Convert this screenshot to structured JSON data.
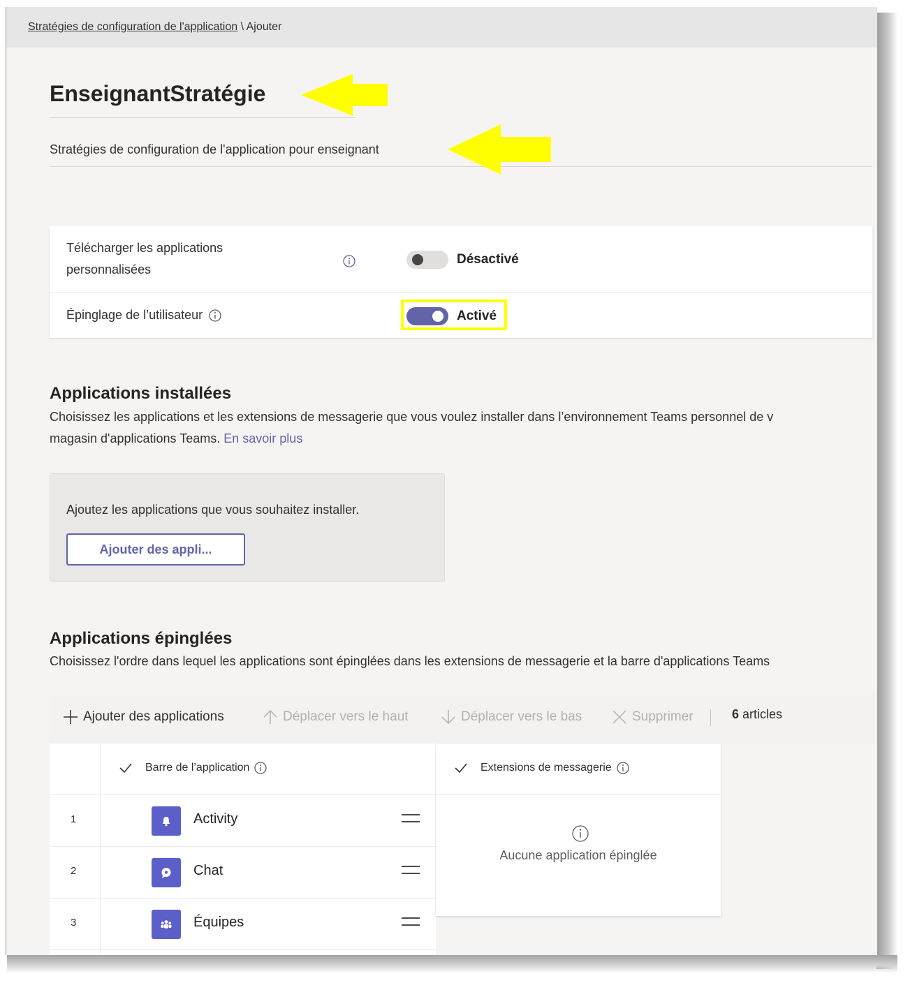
{
  "breadcrumb": {
    "parent_link": "Stratégies de configuration de l'application",
    "separator": " \\ ",
    "current": "Ajouter"
  },
  "policy": {
    "name": "EnseignantStratégie",
    "description": "Stratégies de configuration de l'application pour enseignant"
  },
  "settings": [
    {
      "label_line1": "Télécharger les applications",
      "label_line2": "personnalisées",
      "state_label": "Désactivé",
      "enabled": false
    },
    {
      "label": "Épinglage de l’utilisateur",
      "state_label": "Activé",
      "enabled": true
    }
  ],
  "installed_apps": {
    "heading": "Applications installées",
    "description_line1": "Choisissez les applications et les extensions de messagerie que vous voulez installer dans l’environnement Teams personnel de v",
    "description_line2": "magasin d'applications Teams.",
    "learn_more": "En savoir plus",
    "panel_text": "Ajoutez les applications que vous souhaitez installer.",
    "add_button": "Ajouter des appli..."
  },
  "pinned_apps": {
    "heading": "Applications épinglées",
    "description": "Choisissez l'ordre dans lequel les applications sont épinglées dans les extensions de messagerie et la barre d'applications Teams",
    "toolbar": {
      "add": "Ajouter des applications",
      "move_up": "Déplacer vers le haut",
      "move_down": "Déplacer vers le bas",
      "delete": "Supprimer",
      "count_number": "6",
      "count_label": "articles"
    },
    "app_bar_header": "Barre de l’application",
    "messaging_header": "Extensions de messagerie",
    "empty_message": "Aucune application épinglée",
    "rows": [
      {
        "num": "1",
        "name": "Activity",
        "icon": "bell-icon"
      },
      {
        "num": "2",
        "name": "Chat",
        "icon": "chat-icon"
      },
      {
        "num": "3",
        "name": "Équipes",
        "icon": "teams-icon"
      }
    ]
  },
  "colors": {
    "accent": "#6264a7",
    "app_icon": "#5b5fc7",
    "annotation": "#ffff00"
  }
}
